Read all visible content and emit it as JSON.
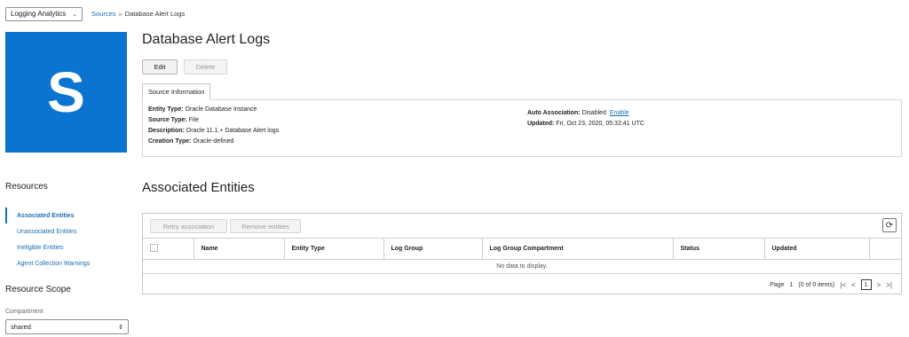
{
  "header": {
    "app_selector": "Logging Analytics",
    "breadcrumb": {
      "parent": "Sources",
      "separator": "»",
      "current": "Database Alert Logs"
    }
  },
  "tile": {
    "letter": "S",
    "color": "#0b74d1"
  },
  "page_title": "Database Alert Logs",
  "actions": {
    "edit": "Edit",
    "delete": "Delete"
  },
  "tab": "Source Information",
  "source_info": {
    "entity_type": {
      "label": "Entity Type:",
      "value": "Oracle Database Instance"
    },
    "source_type": {
      "label": "Source Type:",
      "value": "File"
    },
    "description": {
      "label": "Description:",
      "value": "Oracle 11.1.+ Database Alert logs"
    },
    "creation_type": {
      "label": "Creation Type:",
      "value": "Oracle-defined"
    },
    "auto_association": {
      "label": "Auto Association:",
      "value": "Disabled",
      "link": "Enable"
    },
    "updated": {
      "label": "Updated:",
      "value": "Fri, Oct 23, 2020, 05:32:41 UTC"
    }
  },
  "sidebar": {
    "resources_heading": "Resources",
    "items": [
      {
        "label": "Associated Entities",
        "active": true
      },
      {
        "label": "Unassociated Entities"
      },
      {
        "label": "Ineligible Entities"
      },
      {
        "label": "Agent Collection Warnings"
      }
    ],
    "scope_heading": "Resource Scope",
    "compartment_label": "Compartment",
    "compartment_value": "shared"
  },
  "entities": {
    "title": "Associated Entities",
    "buttons": {
      "retry": "Retry association",
      "remove": "Remove entities"
    },
    "columns": [
      "Name",
      "Entity Type",
      "Log Group",
      "Log Group Compartment",
      "Status",
      "Updated"
    ],
    "empty_message": "No data to display.",
    "pager": {
      "page_label": "Page",
      "page_num": "1",
      "items": "(0 of 0 items)",
      "current": "1"
    }
  },
  "colors": {
    "accent": "#1a6fb5",
    "tile": "#0b74d1"
  }
}
